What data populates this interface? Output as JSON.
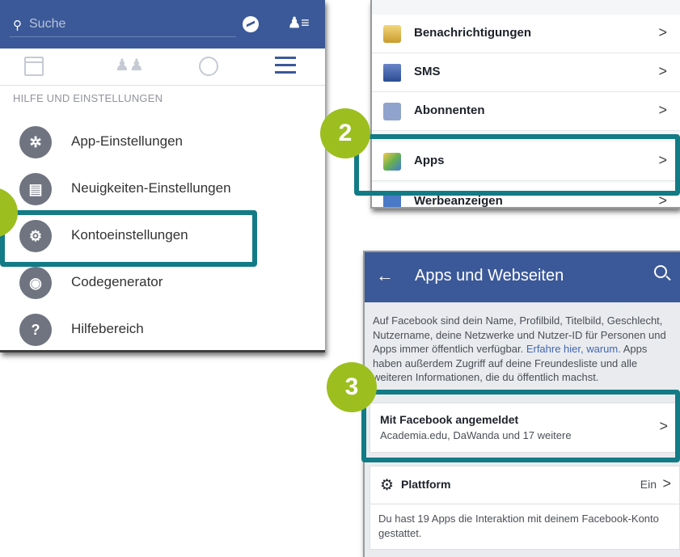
{
  "panel1": {
    "search_placeholder": "Suche",
    "section_title": "HILFE UND EINSTELLUNGEN",
    "items": [
      {
        "label": "App-Einstellungen",
        "icon": "gear-icon",
        "glyph": "✲"
      },
      {
        "label": "Neuigkeiten-Einstellungen",
        "icon": "newsfeed-icon",
        "glyph": "▤"
      },
      {
        "label": "Kontoeinstellungen",
        "icon": "account-settings-icon",
        "glyph": "⚙"
      },
      {
        "label": "Codegenerator",
        "icon": "lock-icon",
        "glyph": "🔒"
      },
      {
        "label": "Hilfebereich",
        "icon": "help-icon",
        "glyph": "?"
      }
    ]
  },
  "panel2": {
    "rows": [
      {
        "label": "Benachrichtigungen",
        "icon": "notifications-icon"
      },
      {
        "label": "SMS",
        "icon": "sms-icon"
      },
      {
        "label": "Abonnenten",
        "icon": "rss-icon"
      },
      {
        "label": "Apps",
        "icon": "apps-icon"
      },
      {
        "label": "Werbeanzeigen",
        "icon": "ads-icon"
      }
    ],
    "chevron": ">"
  },
  "panel3": {
    "title": "Apps und Webseiten",
    "info_text": "Auf Facebook sind dein Name, Profilbild, Titelbild, Geschlecht, Nutzername, deine Netzwerke und Nutzer-ID für Personen und Apps immer öffentlich verfügbar.",
    "info_link": "Erfahre hier, warum.",
    "info_text2": "Apps haben außerdem Zugriff auf deine Freundesliste und alle weiteren Informationen, die du öffentlich machst.",
    "logged_in_title": "Mit Facebook angemeldet",
    "logged_in_subtitle": "Academia.edu, DaWanda und 17 weitere",
    "platform_label": "Plattform",
    "platform_value": "Ein",
    "platform_desc": "Du hast 19 Apps die Interaktion mit deinem Facebook-Konto gestattet."
  },
  "badges": {
    "b2": "2",
    "b3": "3"
  },
  "colors": {
    "facebook_blue": "#3b5998",
    "highlight": "#127b86",
    "badge": "#9cbf1f"
  }
}
